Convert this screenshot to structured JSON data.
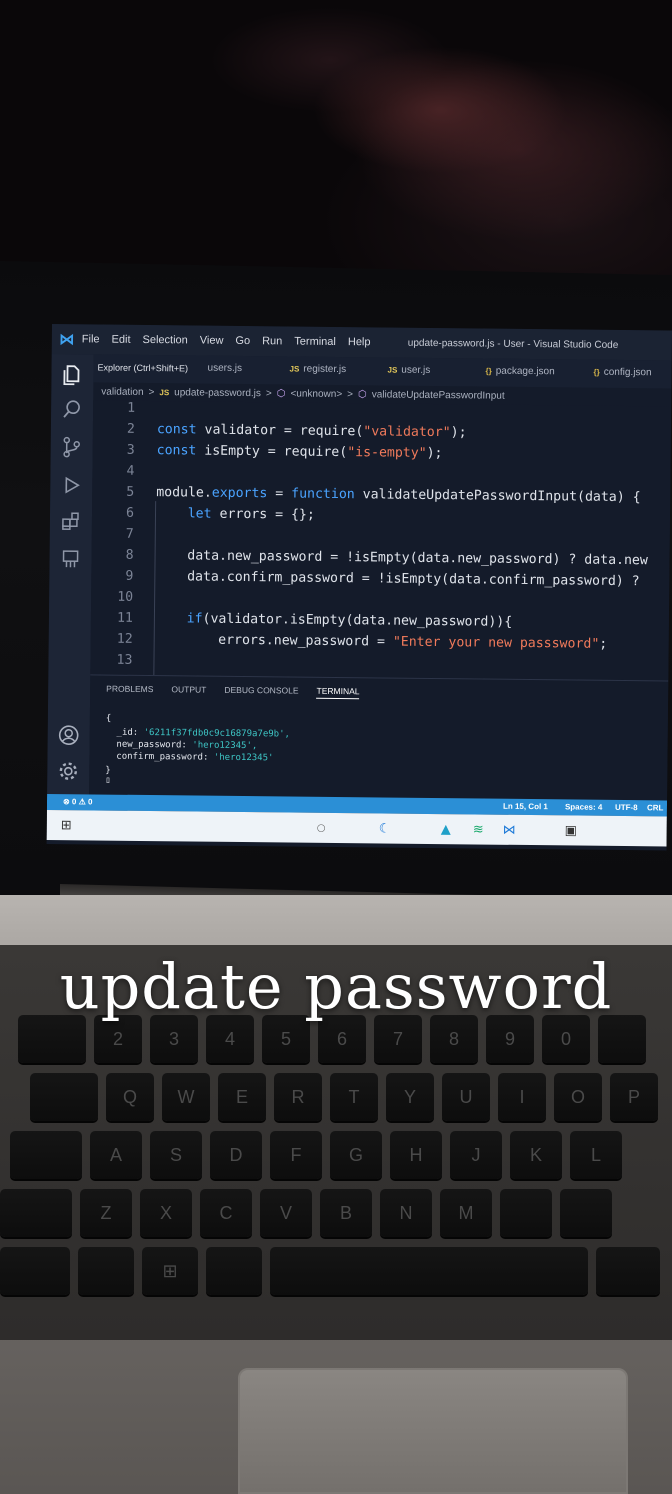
{
  "titlebar": {
    "menu": [
      "File",
      "Edit",
      "Selection",
      "View",
      "Go",
      "Run",
      "Terminal",
      "Help"
    ],
    "window_title": "update-password.js - User - Visual Studio Code"
  },
  "tooltip": "Explorer (Ctrl+Shift+E)",
  "tabs": [
    {
      "icon": "",
      "label": "users.js"
    },
    {
      "icon": "JS",
      "label": "register.js"
    },
    {
      "icon": "JS",
      "label": "user.js"
    },
    {
      "icon": "{}",
      "label": "package.json"
    },
    {
      "icon": "{}",
      "label": "config.json"
    }
  ],
  "breadcrumb": {
    "folder": "validation",
    "sep": ">",
    "file_icon": "JS",
    "file": "update-password.js",
    "symbol1": "<unknown>",
    "symbol2": "validateUpdatePasswordInput"
  },
  "code_lines": [
    {
      "n": "1",
      "t": ""
    },
    {
      "n": "2",
      "t": "const validator = require(\"validator\");"
    },
    {
      "n": "3",
      "t": "const isEmpty = require(\"is-empty\");"
    },
    {
      "n": "4",
      "t": ""
    },
    {
      "n": "5",
      "t": "module.exports = function validateUpdatePasswordInput(data) {"
    },
    {
      "n": "6",
      "t": "    let errors = {};"
    },
    {
      "n": "7",
      "t": ""
    },
    {
      "n": "8",
      "t": "    data.new_password = !isEmpty(data.new_password) ? data.new"
    },
    {
      "n": "9",
      "t": "    data.confirm_password = !isEmpty(data.confirm_password) ?"
    },
    {
      "n": "10",
      "t": ""
    },
    {
      "n": "11",
      "t": "    if(validator.isEmpty(data.new_password)){"
    },
    {
      "n": "12",
      "t": "        errors.new_password = \"Enter your new passsword\";"
    },
    {
      "n": "13",
      "t": ""
    }
  ],
  "panel": {
    "tabs": [
      "PROBLEMS",
      "OUTPUT",
      "DEBUG CONSOLE",
      "TERMINAL"
    ],
    "active_tab": "TERMINAL",
    "terminal": {
      "open": "{",
      "id_key": "  _id: ",
      "id_val": "'6211f37fdb0c9c16879a7e9b',",
      "np_key": "  new_password: ",
      "np_val": "'hero12345',",
      "cp_key": "  confirm_password: ",
      "cp_val": "'hero12345'",
      "close": "}",
      "cursor": "▯"
    }
  },
  "statusbar": {
    "left": "⊗ 0 ⚠ 0",
    "position": "Ln 15, Col 1",
    "spaces": "Spaces: 4",
    "encoding": "UTF-8",
    "eol": "CRL"
  },
  "caption": "update password",
  "keyboard": {
    "row1": [
      "",
      "2",
      "3",
      "4",
      "5",
      "6",
      "7",
      "8",
      "9",
      "0",
      ""
    ],
    "row2": [
      "",
      "Q",
      "W",
      "E",
      "R",
      "T",
      "Y",
      "U",
      "I",
      "O",
      "P"
    ],
    "row3": [
      "",
      "A",
      "S",
      "D",
      "F",
      "G",
      "H",
      "J",
      "K",
      "L"
    ],
    "row4": [
      "",
      "Z",
      "X",
      "C",
      "V",
      "B",
      "N",
      "M",
      "",
      ""
    ]
  },
  "colors": {
    "editor_bg": "#141b2a",
    "statusbar": "#2b8fd6",
    "keyword": "#4aa3ff",
    "string": "#f07a5b"
  }
}
